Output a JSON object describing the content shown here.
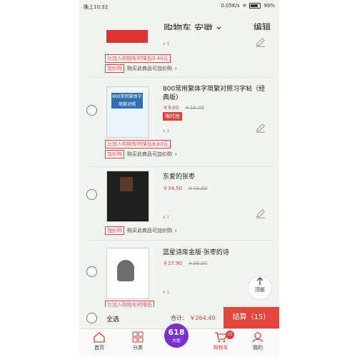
{
  "status": {
    "time": "晚上10:32",
    "speed": "0.05K/s",
    "battery": "99%"
  },
  "header": {
    "title": "购物车 安徽",
    "chevron": "chevron-down-icon",
    "edit": "编辑"
  },
  "promo_text": "比加入购物车时降低",
  "books": [
    {
      "name": "",
      "price": "",
      "old_price": "",
      "promo_drop": "比加入购物车时降低0.40元",
      "addon_tag": "加价购",
      "addon_text": "购买此商品可加价购"
    },
    {
      "name": "800常用繁体字简繁对照习字帖（经典版）",
      "price": "￥9.00",
      "old_price": "￥18.00",
      "flash_badge": "限时抢",
      "qty": "x 1",
      "promo_drop": "比加入购物车时降低8.80元",
      "addon_tag": "加价购",
      "addon_text": "购买此商品可加价购"
    },
    {
      "name": "东爱的张枣",
      "price": "￥34.50",
      "old_price": "￥46.00",
      "qty": "x 1",
      "addon_tag": "加价购",
      "addon_text": "购买此商品可加价购"
    },
    {
      "name": "蓝星诗库金版·张枣的诗",
      "price": "￥27.90",
      "old_price": "￥36.00",
      "qty": "x 1",
      "promo_drop": "比加入购物车时降低"
    }
  ],
  "book_cover_text": {
    "b1": "800常用繁体字 简繁对照"
  },
  "top_button": "顶部",
  "footer": {
    "select_all": "全选",
    "total_label": "合计",
    "total_amount": "￥264.40",
    "settle": "结算（15）"
  },
  "tabs": [
    {
      "label": "首页",
      "icon": "home-icon"
    },
    {
      "label": "分类",
      "icon": "grid-icon"
    },
    {
      "label": "618",
      "sub": "大促",
      "icon": "promo-618-icon"
    },
    {
      "label": "购物车",
      "icon": "cart-icon",
      "badge": "15"
    },
    {
      "label": "我的",
      "icon": "user-icon"
    }
  ],
  "colors": {
    "accent": "#e23b3b",
    "bg": "#f1f4ef",
    "settle_bg": "#e5463c",
    "promo_purple": "#7a2fd0"
  }
}
